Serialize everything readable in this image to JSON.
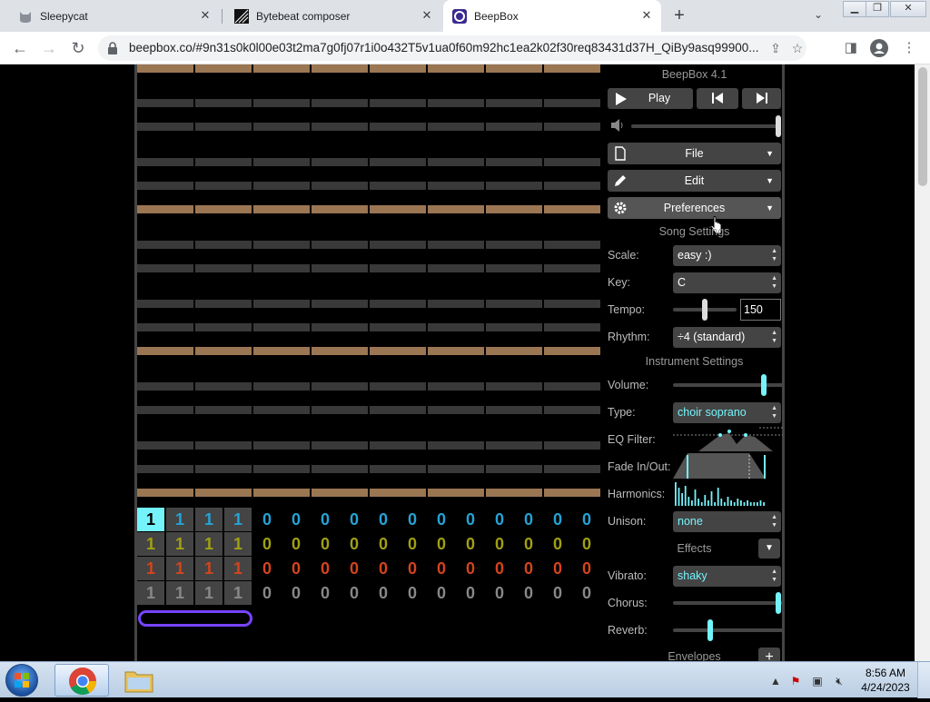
{
  "browser": {
    "tabs": [
      {
        "title": "Sleepycat",
        "active": false,
        "icon": "cat-icon"
      },
      {
        "title": "Bytebeat composer",
        "active": false,
        "icon": "bytebeat-icon"
      },
      {
        "title": "BeepBox",
        "active": true,
        "icon": "beepbox-icon"
      }
    ],
    "url": "beepbox.co/#9n31s0k0l00e03t2ma7g0fj07r1i0o432T5v1ua0f60m92hc1ea2k02f30req83431d37H_QiBy9asq99900..."
  },
  "beepbox": {
    "version": "BeepBox 4.1",
    "play_label": "Play",
    "menus": {
      "file": "File",
      "edit": "Edit",
      "preferences": "Preferences"
    },
    "song_settings": {
      "heading": "Song Settings",
      "scale_label": "Scale:",
      "scale_value": "easy :)",
      "key_label": "Key:",
      "key_value": "C",
      "tempo_label": "Tempo:",
      "tempo_value": "150",
      "rhythm_label": "Rhythm:",
      "rhythm_value": "÷4 (standard)"
    },
    "instrument_settings": {
      "heading": "Instrument Settings",
      "volume_label": "Volume:",
      "type_label": "Type:",
      "type_value": "choir soprano",
      "eq_filter_label": "EQ Filter:",
      "fade_label": "Fade In/Out:",
      "harmonics_label": "Harmonics:",
      "unison_label": "Unison:",
      "unison_value": "none",
      "effects_label": "Effects",
      "vibrato_label": "Vibrato:",
      "vibrato_value": "shaky",
      "chorus_label": "Chorus:",
      "reverb_label": "Reverb:",
      "envelopes_label": "Envelopes"
    },
    "tracks": [
      {
        "color": "#25a3d6",
        "patterns": [
          "1",
          "1",
          "1",
          "1",
          "0",
          "0",
          "0",
          "0",
          "0",
          "0",
          "0",
          "0",
          "0",
          "0",
          "0",
          "0"
        ]
      },
      {
        "color": "#a0a013",
        "patterns": [
          "1",
          "1",
          "1",
          "1",
          "0",
          "0",
          "0",
          "0",
          "0",
          "0",
          "0",
          "0",
          "0",
          "0",
          "0",
          "0"
        ]
      },
      {
        "color": "#d4441c",
        "patterns": [
          "1",
          "1",
          "1",
          "1",
          "0",
          "0",
          "0",
          "0",
          "0",
          "0",
          "0",
          "0",
          "0",
          "0",
          "0",
          "0"
        ]
      },
      {
        "color": "#888888",
        "patterns": [
          "1",
          "1",
          "1",
          "1",
          "0",
          "0",
          "0",
          "0",
          "0",
          "0",
          "0",
          "0",
          "0",
          "0",
          "0",
          "0"
        ]
      }
    ],
    "colors": {
      "octave_row": "#9b7653",
      "note_row": "#393939",
      "selected_pattern": "#74f3fb",
      "loop_bar": "#7744ff"
    }
  },
  "taskbar": {
    "time": "8:56 AM",
    "date": "4/24/2023"
  }
}
